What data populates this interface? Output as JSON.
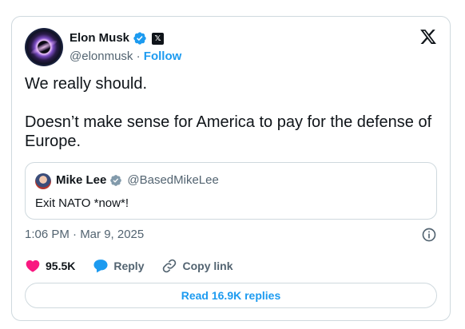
{
  "author": {
    "display_name": "Elon Musk",
    "handle": "@elonmusk",
    "separator": " · ",
    "follow_label": "Follow"
  },
  "tweet": {
    "text": "We really should.\n\nDoesn’t make sense for America to pay for the defense of Europe."
  },
  "quote": {
    "display_name": "Mike Lee",
    "handle": "@BasedMikeLee",
    "text": "Exit NATO *now*!"
  },
  "meta": {
    "timestamp": "1:06 PM · Mar 9, 2025"
  },
  "actions": {
    "likes": "95.5K",
    "reply": "Reply",
    "copy_link": "Copy link"
  },
  "read_replies": "Read 16.9K replies",
  "colors": {
    "accent": "#1d9bf0",
    "like": "#f91880",
    "text": "#0f1419",
    "muted": "#536471",
    "border": "#cfd9de"
  },
  "icons": {
    "verified": "verified-badge-icon",
    "x_logo": "x-logo-icon",
    "info": "info-icon",
    "like": "heart-icon",
    "reply": "reply-bubble-icon",
    "copy_link": "link-icon"
  }
}
